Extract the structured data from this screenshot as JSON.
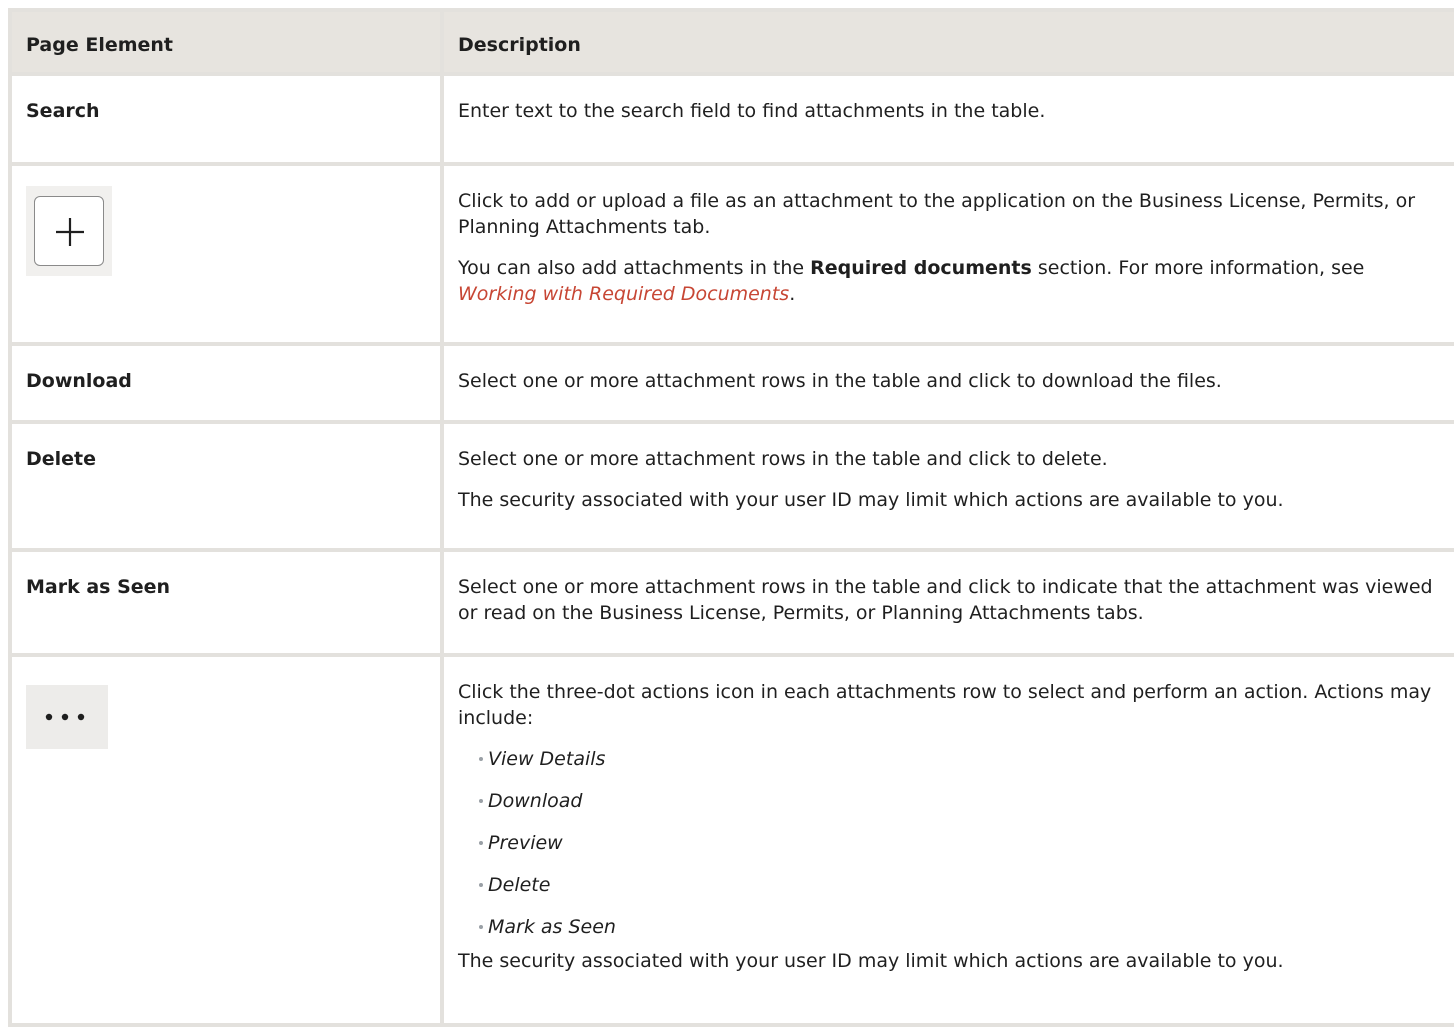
{
  "header": {
    "col1": "Page Element",
    "col2": "Description"
  },
  "rows": [
    {
      "element": "Search",
      "desc": "Enter text to the search field to find attachments in the table."
    },
    {
      "element_icon": "plus-icon",
      "desc1": "Click to add or upload a file as an attachment to the application on the Business License, Permits, or Planning Attachments tab.",
      "desc2_pre": "You can also add attachments in the ",
      "desc2_bold": "Required documents",
      "desc2_mid": " section. For more information, see ",
      "desc2_link": "Working with Required Documents",
      "desc2_post": "."
    },
    {
      "element": "Download",
      "desc": "Select one or more attachment rows in the table and click to download the files."
    },
    {
      "element": "Delete",
      "desc1": "Select one or more attachment rows in the table and click to delete.",
      "desc2": "The security associated with your user ID may limit which actions are available to you."
    },
    {
      "element": "Mark as Seen",
      "desc": "Select one or more attachment rows in the table and click to indicate that the attachment was viewed or read on the Business License, Permits, or Planning Attachments tabs."
    },
    {
      "element_icon": "three-dots-icon",
      "desc1": "Click the three-dot actions icon in each attachments row to select and perform an action. Actions may include:",
      "actions": [
        "View Details",
        "Download",
        "Preview",
        "Delete",
        "Mark as Seen"
      ],
      "desc2": "The security associated with your user ID may limit which actions are available to you."
    }
  ],
  "colors": {
    "border": "#e3e1dd",
    "header_bg": "#e7e4df",
    "link": "#c74634"
  }
}
